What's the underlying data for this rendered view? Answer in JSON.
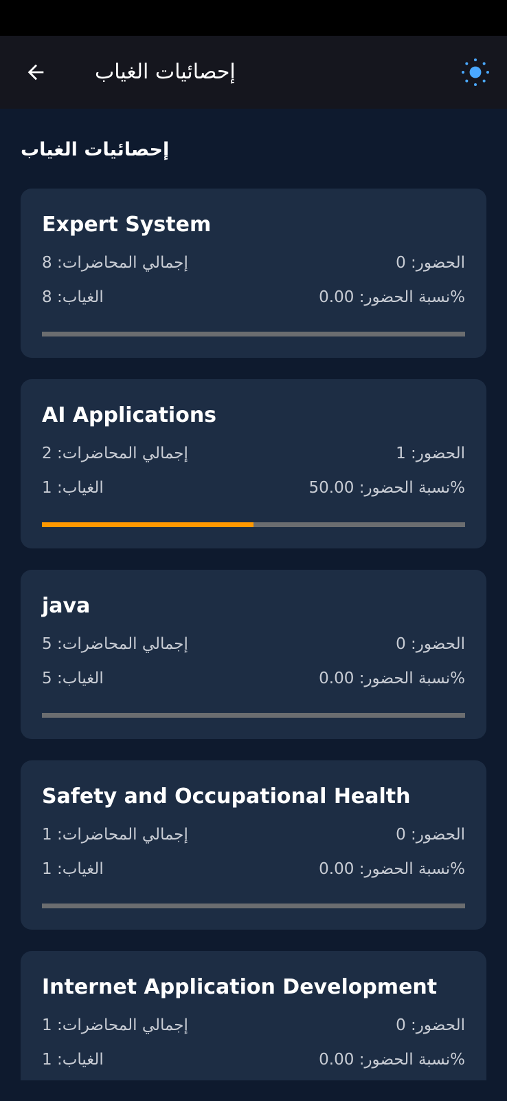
{
  "app_bar": {
    "title": "إحصائيات الغياب"
  },
  "section_title": "إحصائيات الغياب",
  "colors": {
    "progress_fill": "#ff9800",
    "progress_track": "#6b6d70",
    "card_bg": "#1d2d44",
    "page_bg": "#0e1a2e",
    "theme_icon": "#4aa8ff"
  },
  "icons": {
    "back": "arrow-back-icon",
    "theme": "sun-icon"
  },
  "courses": [
    {
      "name": "Expert System",
      "total_lectures": "إجمالي المحاضرات: 8",
      "attendance": "الحضور: 0",
      "absence": "الغياب: 8",
      "attendance_rate": "%نسبة الحضور: 0.00",
      "progress": 0.0
    },
    {
      "name": "AI Applications",
      "total_lectures": "إجمالي المحاضرات: 2",
      "attendance": "الحضور: 1",
      "absence": "الغياب: 1",
      "attendance_rate": "%نسبة الحضور: 50.00",
      "progress": 0.5
    },
    {
      "name": "java",
      "total_lectures": "إجمالي المحاضرات: 5",
      "attendance": "الحضور: 0",
      "absence": "الغياب: 5",
      "attendance_rate": "%نسبة الحضور: 0.00",
      "progress": 0.0
    },
    {
      "name": "Safety and Occupational Health",
      "total_lectures": "إجمالي المحاضرات: 1",
      "attendance": "الحضور: 0",
      "absence": "الغياب: 1",
      "attendance_rate": "%نسبة الحضور: 0.00",
      "progress": 0.0
    },
    {
      "name": "Internet Application Development",
      "total_lectures": "إجمالي المحاضرات: 1",
      "attendance": "الحضور: 0",
      "absence": "الغياب: 1",
      "attendance_rate": "%نسبة الحضور: 0.00",
      "progress": 0.0
    }
  ]
}
